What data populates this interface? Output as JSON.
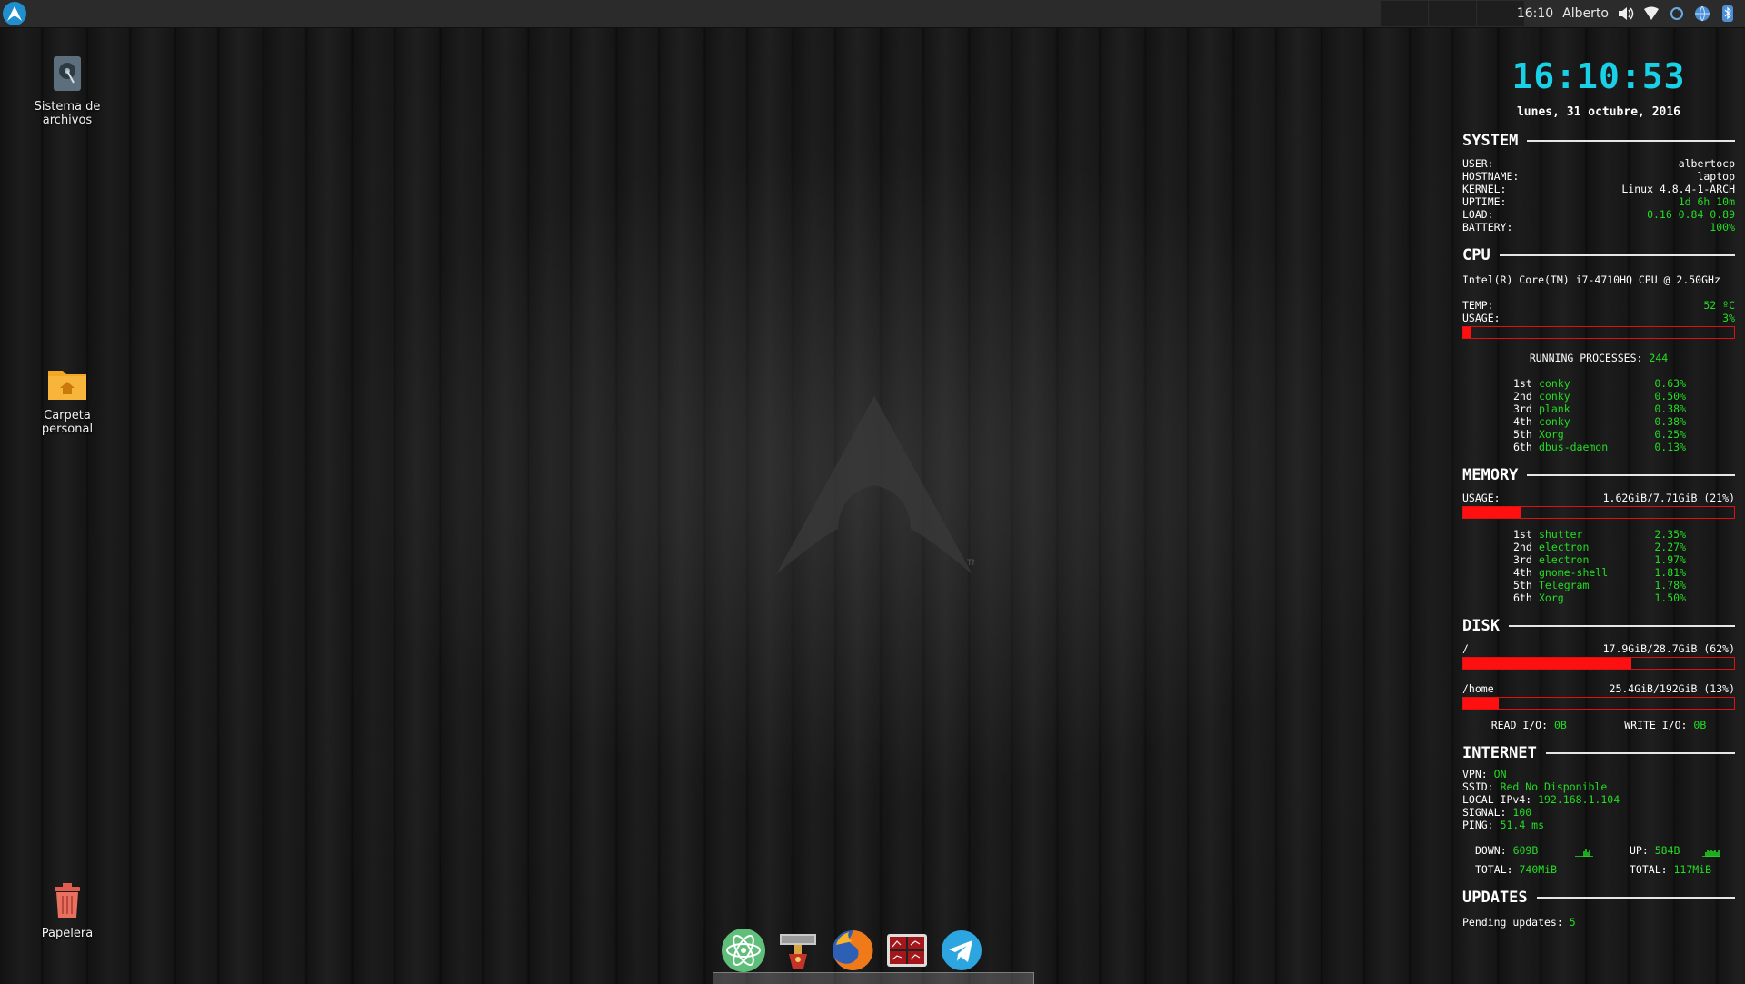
{
  "panel": {
    "time": "16:10",
    "user": "Alberto"
  },
  "desktop": {
    "icons": [
      {
        "label": "Sistema de archivos"
      },
      {
        "label": "Carpeta personal"
      },
      {
        "label": "Papelera"
      }
    ]
  },
  "conky": {
    "clock": "16:10:53",
    "date": "lunes, 31 octubre, 2016",
    "system": {
      "title": "SYSTEM",
      "rows": [
        {
          "k": "USER:",
          "v": "albertocp"
        },
        {
          "k": "HOSTNAME:",
          "v": "laptop"
        },
        {
          "k": "KERNEL:",
          "v": "Linux 4.8.4-1-ARCH"
        },
        {
          "k": "UPTIME:",
          "v": "1d 6h 10m"
        },
        {
          "k": "LOAD:",
          "v": "0.16 0.84 0.89"
        },
        {
          "k": "BATTERY:",
          "v": "100%"
        }
      ]
    },
    "cpu": {
      "title": "CPU",
      "model": "Intel(R) Core(TM) i7-4710HQ CPU @ 2.50GHz",
      "temp_label": "TEMP:",
      "temp": "52 ºC",
      "usage_label": "USAGE:",
      "usage": "3%",
      "usage_fraction": 0.03,
      "running_label": "RUNNING PROCESSES:",
      "running": "244",
      "procs": [
        {
          "rank": "1st",
          "name": "conky",
          "pct": "0.63%"
        },
        {
          "rank": "2nd",
          "name": "conky",
          "pct": "0.50%"
        },
        {
          "rank": "3rd",
          "name": "plank",
          "pct": "0.38%"
        },
        {
          "rank": "4th",
          "name": "conky",
          "pct": "0.38%"
        },
        {
          "rank": "5th",
          "name": "Xorg",
          "pct": "0.25%"
        },
        {
          "rank": "6th",
          "name": "dbus-daemon",
          "pct": "0.13%"
        }
      ]
    },
    "memory": {
      "title": "MEMORY",
      "usage_label": "USAGE:",
      "usage": "1.62GiB/7.71GiB (21%)",
      "usage_fraction": 0.21,
      "procs": [
        {
          "rank": "1st",
          "name": "shutter",
          "pct": "2.35%"
        },
        {
          "rank": "2nd",
          "name": "electron",
          "pct": "2.27%"
        },
        {
          "rank": "3rd",
          "name": "electron",
          "pct": "1.97%"
        },
        {
          "rank": "4th",
          "name": "gnome-shell",
          "pct": "1.81%"
        },
        {
          "rank": "5th",
          "name": "Telegram",
          "pct": "1.78%"
        },
        {
          "rank": "6th",
          "name": "Xorg",
          "pct": "1.50%"
        }
      ]
    },
    "disk": {
      "title": "DISK",
      "root_label": "/",
      "root": "17.9GiB/28.7GiB (62%)",
      "root_fraction": 0.62,
      "home_label": "/home",
      "home": "25.4GiB/192GiB (13%)",
      "home_fraction": 0.13,
      "read_label": "READ I/O:",
      "read": "0B",
      "write_label": "WRITE I/O:",
      "write": "0B"
    },
    "internet": {
      "title": "INTERNET",
      "rows": [
        {
          "k": "VPN:",
          "v": "ON"
        },
        {
          "k": "SSID:",
          "v": "Red No Disponible"
        },
        {
          "k": "LOCAL IPv4:",
          "v": "192.168.1.104"
        },
        {
          "k": "SIGNAL:",
          "v": "100"
        },
        {
          "k": "PING:",
          "v": "51.4 ms"
        }
      ],
      "down_label": "DOWN:",
      "down": "609B",
      "up_label": "UP:",
      "up": "584B",
      "total_label": "TOTAL:",
      "total_down": "740MiB",
      "total_up": "117MiB"
    },
    "updates": {
      "title": "UPDATES",
      "label": "Pending updates:",
      "value": "5"
    }
  },
  "colors": {
    "clock": "#19d1e6",
    "value_green": "#22dd22",
    "bar_red": "#ff1010",
    "arch_blue": "#1f8fd0"
  },
  "dock": {
    "apps": [
      "atom-icon",
      "gimp-icon",
      "firefox-icon",
      "system-monitor-icon",
      "telegram-icon"
    ]
  }
}
